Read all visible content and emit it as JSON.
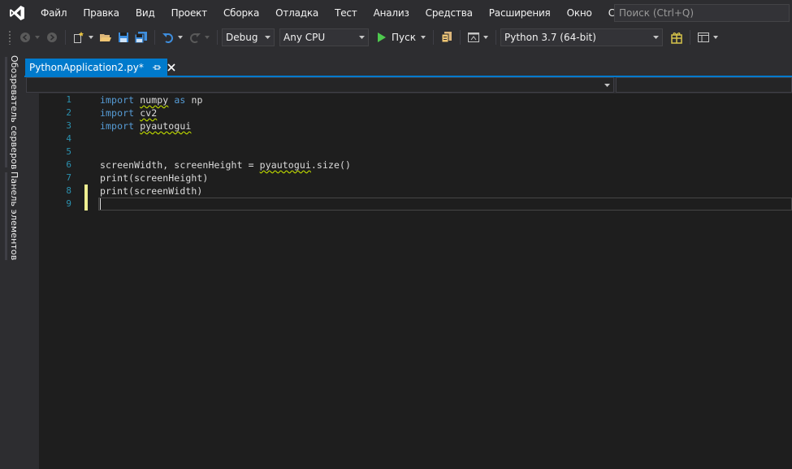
{
  "window": {
    "menu": [
      "Файл",
      "Правка",
      "Вид",
      "Проект",
      "Сборка",
      "Отладка",
      "Тест",
      "Анализ",
      "Средства",
      "Расширения",
      "Окно",
      "Справка"
    ],
    "search_placeholder": "Поиск (Ctrl+Q)"
  },
  "toolbar": {
    "configuration": "Debug",
    "platform": "Any CPU",
    "run_label": "Пуск",
    "environment": "Python 3.7 (64-bit)"
  },
  "side_tabs": [
    "Обозреватель серверов",
    "Панель элементов"
  ],
  "document_tab": {
    "title": "PythonApplication2.py*"
  },
  "editor": {
    "line_numbers": [
      "1",
      "2",
      "3",
      "4",
      "5",
      "6",
      "7",
      "8",
      "9"
    ],
    "lines": [
      {
        "kw": "import",
        "module": "numpy",
        "as": "as",
        "alias": "np"
      },
      {
        "kw": "import",
        "module": "cv2"
      },
      {
        "kw": "import",
        "module": "pyautogui"
      },
      {
        "text": ""
      },
      {
        "text": ""
      },
      {
        "pre": "screenWidth, screenHeight = ",
        "module": "pyautogui",
        "post": ".size()"
      },
      {
        "text": "print(screenHeight)"
      },
      {
        "text": "print(screenWidth)"
      },
      {
        "text": ""
      }
    ],
    "current_line": 9,
    "changed_lines": [
      8,
      9
    ]
  },
  "colors": {
    "accent": "#007acc",
    "background": "#2d2d30",
    "editor_bg": "#1e1e1e",
    "keyword": "#569cd6",
    "line_number": "#2b91af",
    "text": "#dcdcdc",
    "squiggle": "#b8d200",
    "change_marker": "#efef91",
    "run_green": "#4ec94e"
  }
}
